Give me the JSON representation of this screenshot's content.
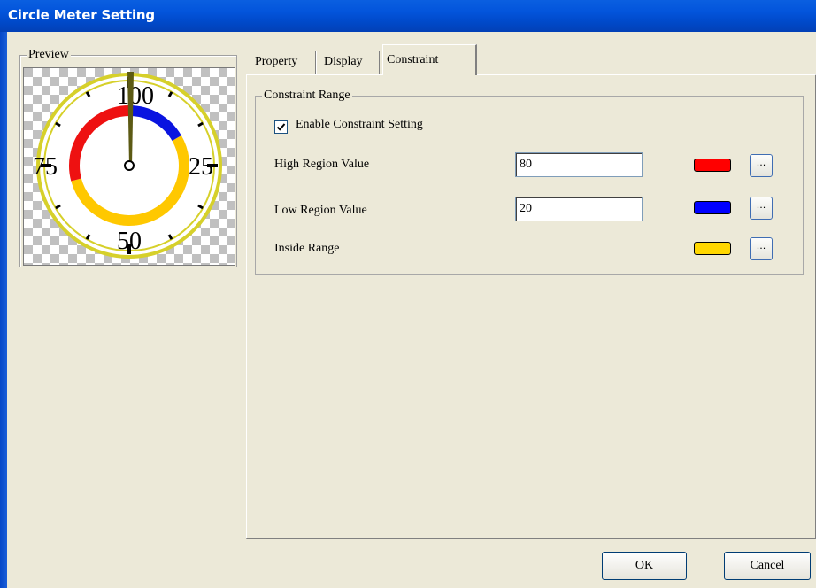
{
  "window": {
    "title": "Circle Meter Setting"
  },
  "preview": {
    "label": "Preview",
    "scale_labels": [
      "100",
      "75",
      "25",
      "50"
    ],
    "colors": {
      "high": "#ee1111",
      "low": "#0a14e0",
      "inside": "#ffc800",
      "rim": "#d6d02a"
    }
  },
  "tabs": [
    {
      "label": "Property"
    },
    {
      "label": "Display"
    },
    {
      "label": "Constraint",
      "active": true
    }
  ],
  "constraint": {
    "group_label": "Constraint Range",
    "enable_label": "Enable Constraint Setting",
    "enable_checked": true,
    "rows": [
      {
        "label": "High Region Value",
        "value": "80",
        "color": "#ff0000",
        "button": "..."
      },
      {
        "label": "Low Region Value",
        "value": "20",
        "color": "#0000ff",
        "button": "..."
      },
      {
        "label": "Inside Range",
        "color": "#ffd700",
        "button": "..."
      }
    ]
  },
  "buttons": {
    "ok": "OK",
    "cancel": "Cancel"
  }
}
